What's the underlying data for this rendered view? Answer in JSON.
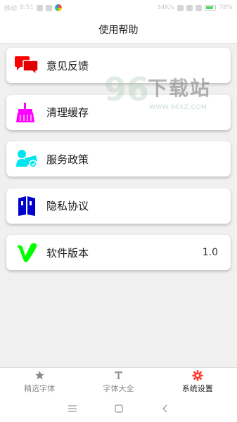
{
  "status_bar": {
    "carrier": "移动",
    "time": "8:51",
    "speed": "34K/s",
    "battery": "78%"
  },
  "header": {
    "title": "使用帮助"
  },
  "menu": {
    "items": [
      {
        "label": "意见反馈",
        "icon": "feedback-chat-icon",
        "color": "#ff0000"
      },
      {
        "label": "清理缓存",
        "icon": "broom-icon",
        "color": "#ff00ff"
      },
      {
        "label": "服务政策",
        "icon": "service-icon",
        "color": "#00e5ee"
      },
      {
        "label": "隐私协议",
        "icon": "privacy-book-icon",
        "color": "#0000cc"
      },
      {
        "label": "软件版本",
        "icon": "version-v-icon",
        "color": "#00ff00",
        "value": "1.0"
      }
    ]
  },
  "watermark": {
    "number": "96",
    "text": "下载站",
    "url": "WWW.96XZ.COM"
  },
  "tabs": [
    {
      "label": "精选字体",
      "icon": "star-icon",
      "active": false
    },
    {
      "label": "字体大全",
      "icon": "font-t-icon",
      "active": false
    },
    {
      "label": "系统设置",
      "icon": "gear-icon",
      "active": true,
      "color": "#ff3b30"
    }
  ]
}
